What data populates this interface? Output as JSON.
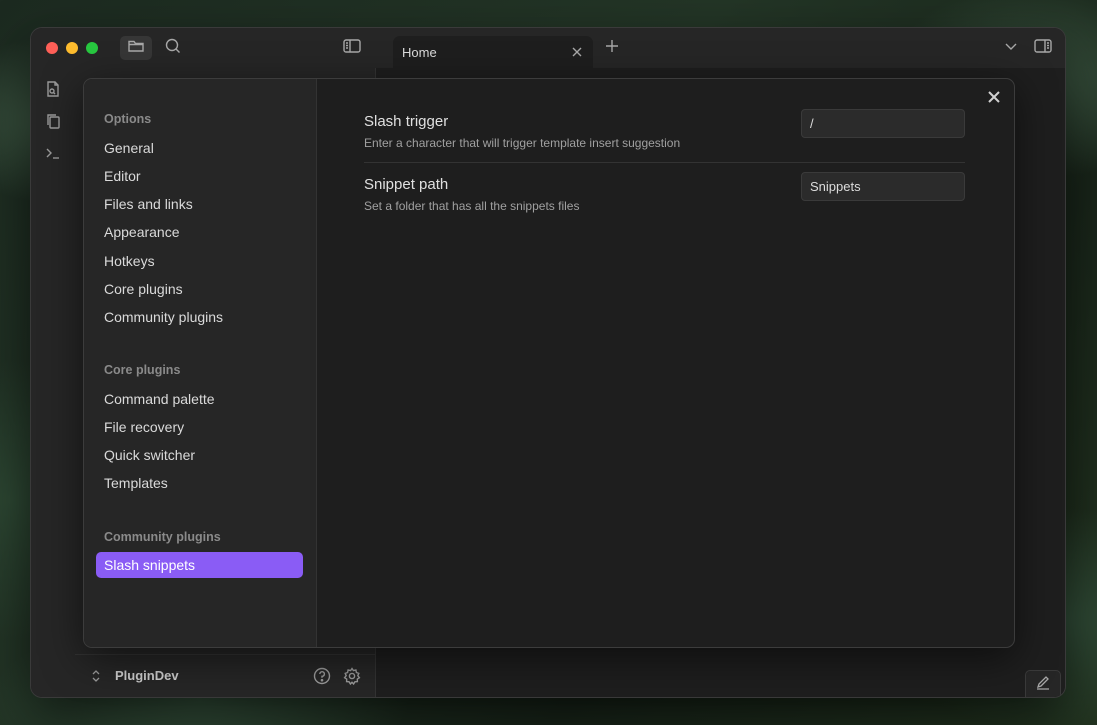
{
  "window": {
    "tab_title": "Home"
  },
  "icons": {
    "files": "folder-icon",
    "search": "search-icon",
    "sidebar_toggle": "sidebar-left-icon",
    "new_tab": "plus-icon",
    "tab_list": "chevron-down-icon",
    "right_sidebar": "sidebar-right-icon"
  },
  "vault": {
    "name": "PluginDev"
  },
  "settings_sidebar": {
    "options_heading": "Options",
    "options": [
      "General",
      "Editor",
      "Files and links",
      "Appearance",
      "Hotkeys",
      "Core plugins",
      "Community plugins"
    ],
    "core_heading": "Core plugins",
    "core": [
      "Command palette",
      "File recovery",
      "Quick switcher",
      "Templates"
    ],
    "community_heading": "Community plugins",
    "community": [
      "Slash snippets"
    ],
    "active": "Slash snippets"
  },
  "settings": [
    {
      "name": "Slash trigger",
      "description": "Enter a character that will trigger template insert suggestion",
      "value": "/"
    },
    {
      "name": "Snippet path",
      "description": "Set a folder that has all the snippets files",
      "value": "Snippets"
    }
  ],
  "colors": {
    "accent": "#8a5cf5",
    "background": "#1e1e1e",
    "sidebar": "#262626"
  }
}
